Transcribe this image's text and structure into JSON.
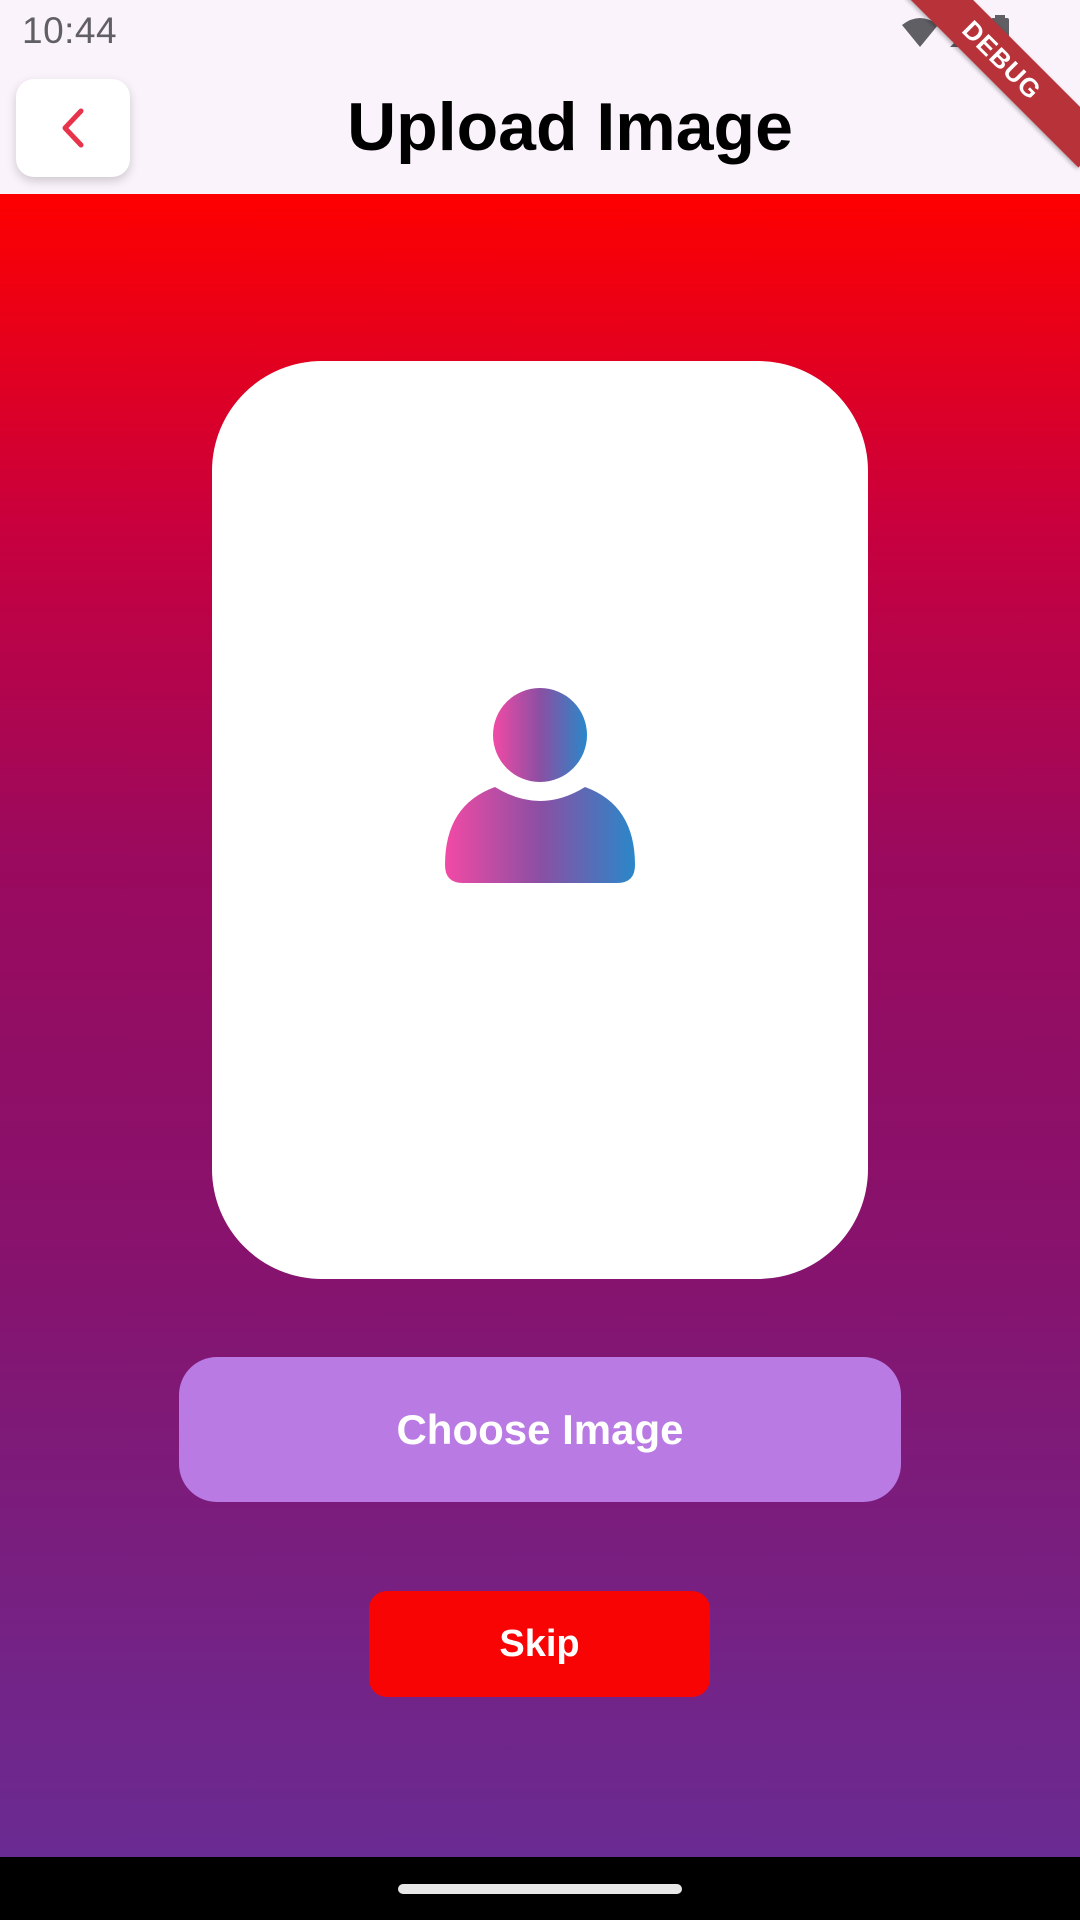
{
  "status_bar": {
    "time": "10:44",
    "icons": [
      "wifi-icon",
      "cellular-signal-icon",
      "battery-icon"
    ]
  },
  "app_bar": {
    "title": "Upload Image",
    "back_icon": "chevron-left-icon"
  },
  "debug_banner": {
    "label": "DEBUG"
  },
  "upload_card": {
    "placeholder_icon": "person-icon"
  },
  "actions": {
    "choose_image_label": "Choose Image",
    "skip_label": "Skip"
  },
  "colors": {
    "gradient_top": "#fe0000",
    "gradient_bottom": "#6a2b92",
    "choose_button": "#b97ae3",
    "skip_button": "#f90404",
    "back_chevron": "#e8344a",
    "icon_gradient_start": "#f24aa5",
    "icon_gradient_end": "#2a87c9"
  }
}
